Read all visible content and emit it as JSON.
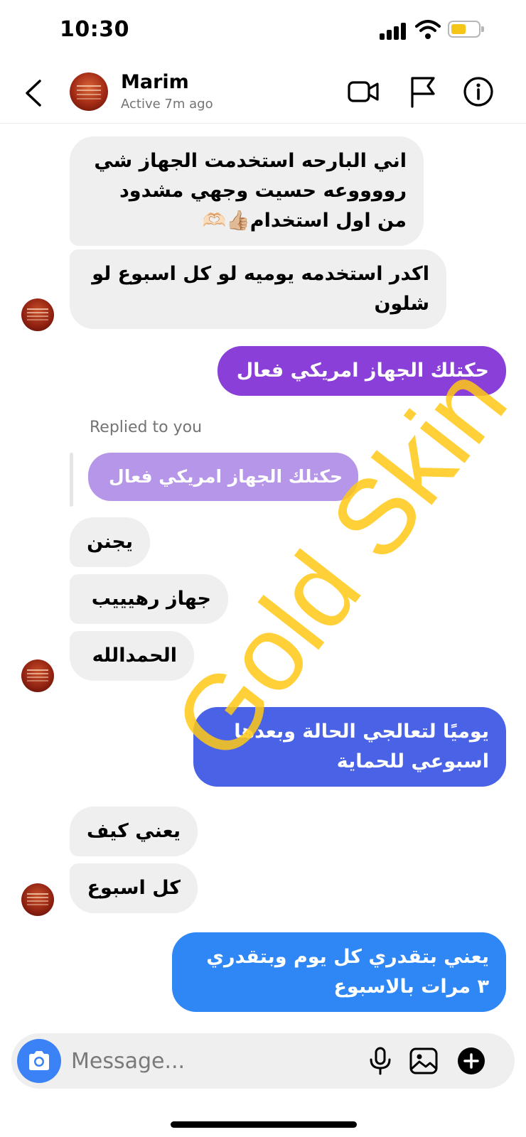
{
  "status_bar": {
    "time": "10:30"
  },
  "header": {
    "name": "Marim",
    "status": "Active 7m ago"
  },
  "messages": [
    {
      "id": "m1",
      "side": "in",
      "text": "اني البارحه استخدمت الجهاز شي رووووعه حسيت وجهي مشدود من اول استخدام👍🏼🫶🏻"
    },
    {
      "id": "m2",
      "side": "in",
      "text": "اكدر استخدمه يوميه لو كل اسبوع لو شلون"
    },
    {
      "id": "m3",
      "side": "out",
      "text": "حكتلك الجهاز امريكي فعال"
    },
    {
      "id": "m4",
      "side": "in",
      "text": "يجنن"
    },
    {
      "id": "m5",
      "side": "in",
      "text": "جهاز رهيييب"
    },
    {
      "id": "m6",
      "side": "in",
      "text": "الحمدالله"
    },
    {
      "id": "m7",
      "side": "out",
      "text": "يوميًا لتعالجي الحالة وبعدها اسبوعي للحماية"
    },
    {
      "id": "m8",
      "side": "in",
      "text": "يعني كيف"
    },
    {
      "id": "m9",
      "side": "in",
      "text": "كل اسبوع"
    },
    {
      "id": "m10",
      "side": "out",
      "text": "يعني بتقدري كل يوم وبتقدري ٣ مرات بالاسبوع"
    }
  ],
  "reply": {
    "label": "Replied to you",
    "quote": "حكتلك الجهاز امريكي فعال"
  },
  "watermark": "Gold Skin",
  "composer": {
    "placeholder": "Message..."
  },
  "colors": {
    "outgoing_top": "#8a3fd8",
    "outgoing_mid": "#4a63e6",
    "outgoing_bottom": "#2f86f5",
    "incoming": "#efefef",
    "camera": "#3b82f6",
    "watermark": "#ffc814"
  },
  "icons": [
    "back-icon",
    "video-call-icon",
    "flag-icon",
    "info-icon",
    "camera-icon",
    "microphone-icon",
    "gallery-icon",
    "add-icon"
  ]
}
